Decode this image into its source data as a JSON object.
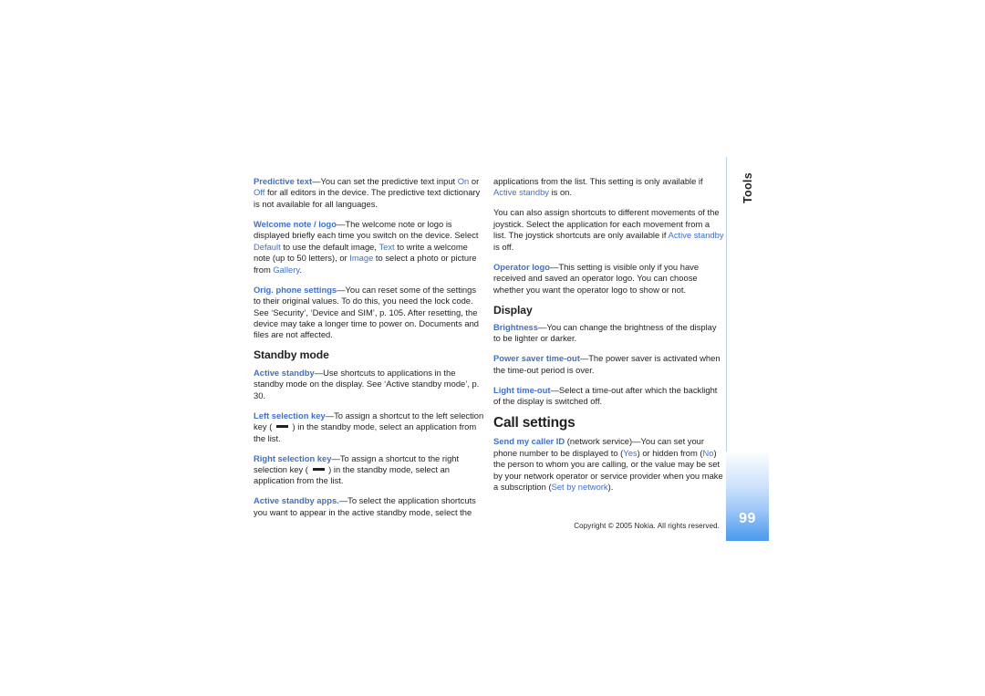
{
  "side_tab": {
    "label": "Tools",
    "page_number": "99",
    "gradient_top": "#ffffff",
    "gradient_bottom": "#4d9bed",
    "rule_color": "#b8d4ea"
  },
  "colors": {
    "link_blue": "#3f6fd6",
    "body_text": "#231f20",
    "page_background": "#ffffff"
  },
  "footer": {
    "copyright": "Copyright © 2005 Nokia. All rights reserved."
  },
  "left_column": {
    "paragraphs": [
      {
        "id": "predictive-text",
        "runs": [
          {
            "t": "Predictive text",
            "s": "link"
          },
          {
            "t": "—You can set the predictive text input ",
            "s": "body"
          },
          {
            "t": "On",
            "s": "link-n"
          },
          {
            "t": " or ",
            "s": "body"
          },
          {
            "t": "Off",
            "s": "link-n"
          },
          {
            "t": " for all editors in the device. The predictive text dictionary is not available for all languages.",
            "s": "body"
          }
        ]
      },
      {
        "id": "welcome-note-logo",
        "runs": [
          {
            "t": "Welcome note / logo",
            "s": "link"
          },
          {
            "t": "—The welcome note or logo is displayed briefly each time you switch on the device. Select ",
            "s": "body"
          },
          {
            "t": "Default",
            "s": "link-n"
          },
          {
            "t": " to use the default image, ",
            "s": "body"
          },
          {
            "t": "Text",
            "s": "link-n"
          },
          {
            "t": " to write a welcome note (up to 50 letters), or ",
            "s": "body"
          },
          {
            "t": "Image",
            "s": "link-n"
          },
          {
            "t": " to select a photo or picture from ",
            "s": "body"
          },
          {
            "t": "Gallery",
            "s": "link-n"
          },
          {
            "t": ".",
            "s": "body"
          }
        ]
      },
      {
        "id": "orig-phone-settings",
        "runs": [
          {
            "t": "Orig. phone settings",
            "s": "link"
          },
          {
            "t": "—You can reset some of the settings to their original values. To do this, you need the lock code. See ‘Security’, ‘Device and SIM’, p. 105. After resetting, the device may take a longer time to power on. Documents and files are not affected.",
            "s": "body"
          }
        ]
      }
    ],
    "subheading": "Standby mode",
    "paragraphs_after": [
      {
        "id": "active-standby",
        "runs": [
          {
            "t": "Active standby",
            "s": "link"
          },
          {
            "t": "—Use shortcuts to applications in the standby mode on the display. See ‘Active standby mode’, p. 30.",
            "s": "body"
          }
        ]
      },
      {
        "id": "left-selection-key",
        "runs": [
          {
            "t": "Left selection key",
            "s": "link"
          },
          {
            "t": "—To assign a shortcut to the left selection key ( ",
            "s": "body"
          },
          {
            "t": "",
            "s": "softkey"
          },
          {
            "t": " ) in the standby mode, select an application from the list.",
            "s": "body"
          }
        ]
      },
      {
        "id": "right-selection-key",
        "runs": [
          {
            "t": "Right selection key",
            "s": "link"
          },
          {
            "t": "—To assign a shortcut to the right selection key ( ",
            "s": "body"
          },
          {
            "t": "",
            "s": "softkey"
          },
          {
            "t": " ) in the standby mode, select an application from the list.",
            "s": "body"
          }
        ]
      },
      {
        "id": "active-standby-apps",
        "runs": [
          {
            "t": "Active standby apps.",
            "s": "link"
          },
          {
            "t": "—To select the application shortcuts you want to appear in the active standby mode, select the",
            "s": "body"
          }
        ]
      }
    ]
  },
  "right_column": {
    "paragraphs": [
      {
        "id": "continuation-applications",
        "runs": [
          {
            "t": "applications from the list. This setting is only available if ",
            "s": "body"
          },
          {
            "t": "Active standby",
            "s": "link-n"
          },
          {
            "t": " is on.",
            "s": "body"
          }
        ]
      },
      {
        "id": "joystick-shortcuts",
        "runs": [
          {
            "t": "You can also assign shortcuts to different movements of the joystick. Select the application for each movement from a list. The joystick shortcuts are only available if ",
            "s": "body"
          },
          {
            "t": "Active standby",
            "s": "link-n"
          },
          {
            "t": " is off.",
            "s": "body"
          }
        ]
      },
      {
        "id": "operator-logo",
        "runs": [
          {
            "t": "Operator logo",
            "s": "link"
          },
          {
            "t": "—This setting is visible only if you have received and saved an operator logo. You can choose whether you want the operator logo to show or not.",
            "s": "body"
          }
        ]
      }
    ],
    "subheading": "Display",
    "display_paragraphs": [
      {
        "id": "brightness",
        "runs": [
          {
            "t": "Brightness",
            "s": "link"
          },
          {
            "t": "—You can change the brightness of the display to be lighter or darker.",
            "s": "body"
          }
        ]
      },
      {
        "id": "power-saver-time-out",
        "runs": [
          {
            "t": "Power saver time-out",
            "s": "link"
          },
          {
            "t": "—The power saver is activated when the time-out period is over.",
            "s": "body"
          }
        ]
      },
      {
        "id": "light-time-out",
        "runs": [
          {
            "t": "Light time-out",
            "s": "link"
          },
          {
            "t": "—Select a time-out after which the backlight of the display is switched off.",
            "s": "body"
          }
        ]
      }
    ],
    "heading": "Call settings",
    "call_paragraphs": [
      {
        "id": "send-my-caller-id",
        "runs": [
          {
            "t": "Send my caller ID",
            "s": "link"
          },
          {
            "t": " (network service)—You can set your phone number to be displayed to (",
            "s": "body"
          },
          {
            "t": "Yes",
            "s": "link-n"
          },
          {
            "t": ") or hidden from (",
            "s": "body"
          },
          {
            "t": "No",
            "s": "link-n"
          },
          {
            "t": ") the person to whom you are calling, or the value may be set by your network operator or service provider when you make a subscription (",
            "s": "body"
          },
          {
            "t": "Set by network",
            "s": "link-n"
          },
          {
            "t": ").",
            "s": "body"
          }
        ]
      }
    ]
  }
}
